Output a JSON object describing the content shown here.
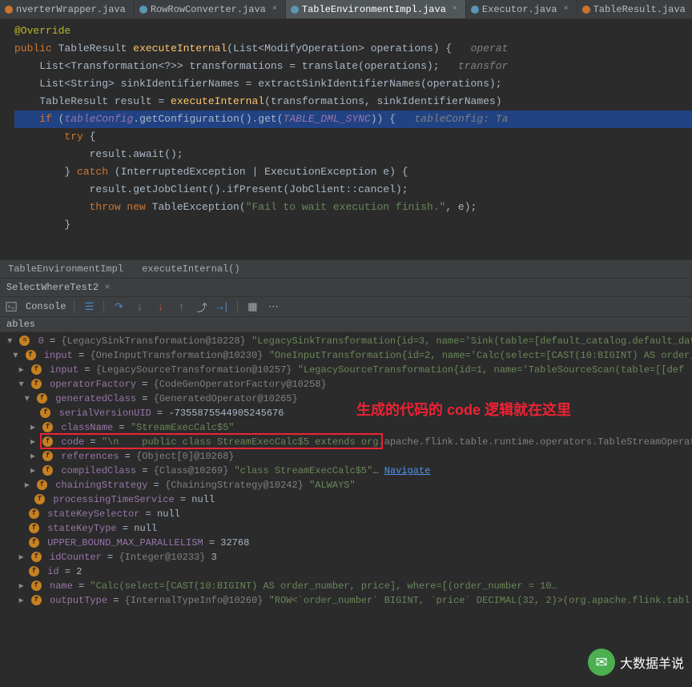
{
  "tabs": [
    {
      "label": "nverterWrapper.java",
      "active": false,
      "dot": "o"
    },
    {
      "label": "RowRowConverter.java",
      "active": false,
      "dot": "b"
    },
    {
      "label": "TableEnvironmentImpl.java",
      "active": true,
      "dot": "b"
    },
    {
      "label": "Executor.java",
      "active": false,
      "dot": "b"
    },
    {
      "label": "TableResult.java",
      "active": false,
      "dot": "o"
    }
  ],
  "code": {
    "l1": "@Override",
    "l2a": "public",
    "l2b": "TableResult",
    "l2c": "executeInternal",
    "l2d": "(List<ModifyOperation> operations) {",
    "l2e": "operat",
    "l3a": "List<Transformation<?>> transformations = translate(operations);",
    "l3b": "transfor",
    "l4": "List<String> sinkIdentifierNames = extractSinkIdentifierNames(operations);",
    "l5a": "TableResult result = ",
    "l5b": "executeInternal",
    "l5c": "(transformations, sinkIdentifierNames)",
    "l6a": "if",
    "l6b": "(",
    "l6c": "tableConfig",
    "l6d": ".getConfiguration().get(",
    "l6e": "TABLE_DML_SYNC",
    "l6f": ")) {",
    "l6g": "tableConfig: Ta",
    "l7a": "try",
    "l7b": " {",
    "l8": "result.await();",
    "l9a": "} ",
    "l9b": "catch",
    "l9c": " (InterruptedException | ExecutionException e) {",
    "l10": "result.getJobClient().ifPresent(JobClient::cancel);",
    "l11a": "throw new",
    "l11b": " TableException(",
    "l11c": "\"Fail to wait execution finish.\"",
    "l11d": ", e);",
    "l12": "}"
  },
  "breadcrumb": {
    "cls": "TableEnvironmentImpl",
    "method": "executeInternal()"
  },
  "debugSession": "SelectWhereTest2",
  "console": "Console",
  "varsHeader": "ables",
  "toolbarIcons": [
    "play",
    "threads",
    "io1",
    "io2",
    "io3",
    "io4",
    "io5",
    "io6",
    "grid",
    "more"
  ],
  "vars": {
    "r0": {
      "name": "0",
      "ref": "{LegacySinkTransformation@10228}",
      "val": "\"LegacySinkTransformation{id=3, name='Sink(table=[default_catalog.default_databas"
    },
    "r1": {
      "name": "input",
      "ref": "{OneInputTransformation@10230}",
      "val": "\"OneInputTransformation{id=2, name='Calc(select=[CAST(10:BIGINT) AS order_"
    },
    "r2": {
      "name": "input",
      "ref": "{LegacySourceTransformation@10257}",
      "val": "\"LegacySourceTransformation{id=1, name='TableSourceScan(table=[[def"
    },
    "r3": {
      "name": "operatorFactory",
      "ref": "{CodeGenOperatorFactory@10258}"
    },
    "r4": {
      "name": "generatedClass",
      "ref": "{GeneratedOperator@10265}"
    },
    "r5": {
      "name": "serialVersionUID",
      "val": "-7355875544905245676"
    },
    "r6": {
      "name": "className",
      "val": "\"StreamExecCalc$5\""
    },
    "r7": {
      "name": "code",
      "val1": "\"\\n",
      "val2": "public class StreamExecCalc$5 extends org",
      "val3": ".apache.flink.table.runtime.operators.TableStreamOperat"
    },
    "r8": {
      "name": "references",
      "ref": "{Object[0]@10268}"
    },
    "r9": {
      "name": "compiledClass",
      "ref": "{Class@10269}",
      "val": "\"class StreamExecCalc$5\"",
      "navigate": "Navigate"
    },
    "r10": {
      "name": "chainingStrategy",
      "ref": "{ChainingStrategy@10242}",
      "val": "\"ALWAYS\""
    },
    "r11": {
      "name": "processingTimeService",
      "val": "null"
    },
    "r12": {
      "name": "stateKeySelector",
      "val": "null"
    },
    "r13": {
      "name": "stateKeyType",
      "val": "null"
    },
    "r14": {
      "name": "UPPER_BOUND_MAX_PARALLELISM",
      "val": "32768"
    },
    "r15": {
      "name": "idCounter",
      "ref": "{Integer@10233}",
      "val": "3"
    },
    "r16": {
      "name": "id",
      "val": "2"
    },
    "r17": {
      "name": "name",
      "val": "\"Calc(select=[CAST(10:BIGINT) AS order_number, price], where=[(order_number = 10…"
    },
    "r18": {
      "name": "outputType",
      "ref": "{InternalTypeInfo@10260}",
      "val": "\"ROW<`order_number` BIGINT, `price` DECIMAL(32, 2)>(org.apache.flink.tabl"
    }
  },
  "annotation": "生成的代码的 code 逻辑就在这里",
  "watermark": "大数据羊说"
}
